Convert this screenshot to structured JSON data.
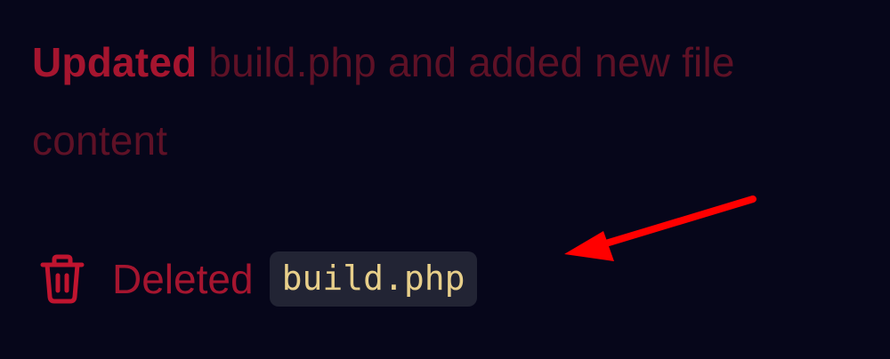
{
  "update": {
    "verb": "Updated",
    "text": "build.php and added new file content"
  },
  "deletion": {
    "icon": "trash-icon",
    "label": "Deleted",
    "filename": "build.php"
  },
  "colors": {
    "background": "#06061a",
    "accent": "#a5152f",
    "faded_text": "#5e1126",
    "chip_background": "#222434",
    "chip_text": "#e8cf8a",
    "annotation_arrow": "#ff0000"
  }
}
